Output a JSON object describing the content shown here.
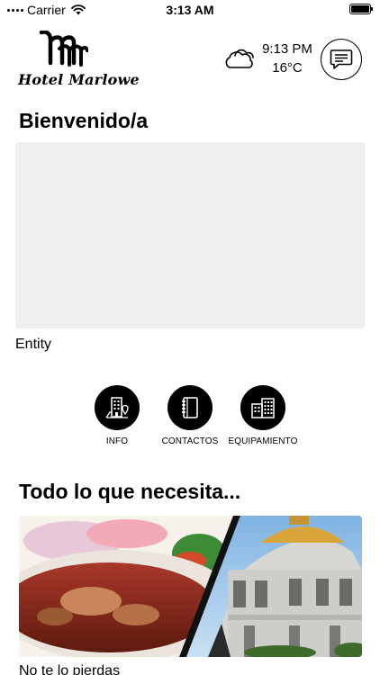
{
  "status_bar": {
    "carrier": "Carrier",
    "time": "3:13 AM"
  },
  "header": {
    "logo_text": "Hotel Marlowe",
    "weather_icon": "cloud-icon",
    "weather_time": "9:13 PM",
    "weather_temp": "16°C",
    "messages_icon": "message-icon"
  },
  "welcome_title": "Bienvenido/a",
  "entity_label": "Entity",
  "actions": [
    {
      "label": "INFO",
      "icon": "building-location-icon"
    },
    {
      "label": "CONTACTOS",
      "icon": "address-book-icon"
    },
    {
      "label": "EQUIPAMIENTO",
      "icon": "buildings-icon"
    }
  ],
  "section_title": "Todo lo que necesita...",
  "promo": {
    "caption": "No te lo pierdas",
    "colors": {
      "food": "#8a2a18",
      "sky": "#9cc7ea",
      "palace": "#d9d9d6",
      "dome": "#d8a83a"
    }
  }
}
